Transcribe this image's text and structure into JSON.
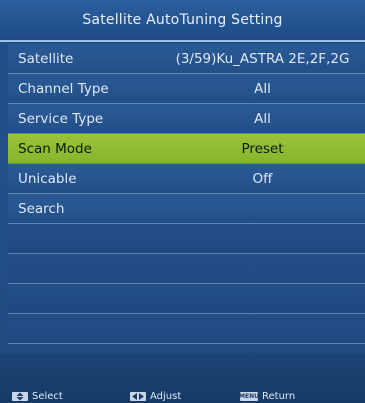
{
  "title": "Satellite AutoTuning Setting",
  "menu": {
    "rows": [
      {
        "label": "Satellite",
        "value": "(3/59)Ku_ASTRA 2E,2F,2G"
      },
      {
        "label": "Channel Type",
        "value": "All"
      },
      {
        "label": "Service Type",
        "value": "All"
      },
      {
        "label": "Scan Mode",
        "value": "Preset"
      },
      {
        "label": "Unicable",
        "value": "Off"
      },
      {
        "label": "Search",
        "value": ""
      }
    ],
    "selected_index": 3
  },
  "footer": {
    "select_label": "Select",
    "adjust_label": "Adjust",
    "return_label": "Return",
    "menu_key": "MENU"
  },
  "colors": {
    "selected_row": "#8fbd31",
    "menu_background": "#234f88"
  },
  "icons": {
    "select": "up-down-arrows-icon",
    "adjust": "left-right-arrows-icon",
    "return": "menu-key-icon"
  }
}
